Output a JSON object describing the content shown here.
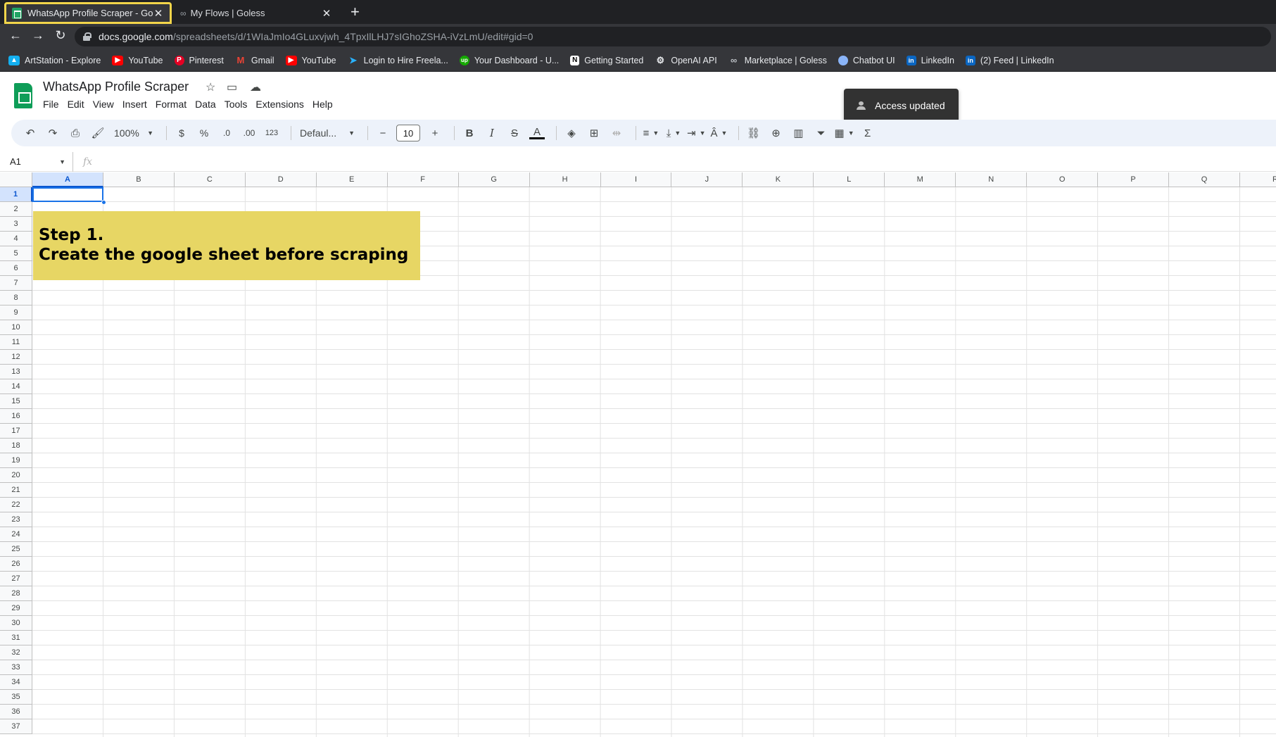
{
  "browser": {
    "tabs": [
      {
        "title": "WhatsApp Profile Scraper - Goog",
        "active": true
      },
      {
        "title": "My Flows | Goless",
        "active": false
      }
    ],
    "url_host": "docs.google.com",
    "url_path": "/spreadsheets/d/1WIaJmIo4GLuxvjwh_4TpxIlLHJ7sIGhoZSHA-iVzLmU/edit#gid=0",
    "bookmarks": [
      {
        "label": "ArtStation - Explore",
        "icon": "artstation-icon"
      },
      {
        "label": "YouTube",
        "icon": "youtube-icon"
      },
      {
        "label": "Pinterest",
        "icon": "pinterest-icon"
      },
      {
        "label": "Gmail",
        "icon": "gmail-icon"
      },
      {
        "label": "YouTube",
        "icon": "youtube-icon"
      },
      {
        "label": "Login to Hire Freela...",
        "icon": "freelancer-icon"
      },
      {
        "label": "Your Dashboard - U...",
        "icon": "upwork-icon"
      },
      {
        "label": "Getting Started",
        "icon": "notion-icon"
      },
      {
        "label": "OpenAI API",
        "icon": "openai-icon"
      },
      {
        "label": "Marketplace | Goless",
        "icon": "goless-icon"
      },
      {
        "label": "Chatbot UI",
        "icon": "chatbot-icon"
      },
      {
        "label": "LinkedIn",
        "icon": "linkedin-icon"
      },
      {
        "label": "(2) Feed | LinkedIn",
        "icon": "linkedin-icon"
      }
    ]
  },
  "sheet": {
    "title": "WhatsApp Profile Scraper",
    "menu": [
      "File",
      "Edit",
      "View",
      "Insert",
      "Format",
      "Data",
      "Tools",
      "Extensions",
      "Help"
    ],
    "toast": "Access updated",
    "toolbar": {
      "zoom": "100%",
      "currency": "$",
      "percent": "%",
      "decrease_decimal": ".0",
      "increase_decimal": ".00",
      "number_format": "123",
      "font": "Defaul...",
      "font_size": "10",
      "bold": "B",
      "italic": "I",
      "strikethrough": "S",
      "text_color": "A",
      "functions": "Σ"
    },
    "name_box": "A1",
    "fx": "fx",
    "columns": [
      "A",
      "B",
      "C",
      "D",
      "E",
      "F",
      "G",
      "H",
      "I",
      "J",
      "K",
      "L",
      "M",
      "N",
      "O",
      "P",
      "Q",
      "R"
    ],
    "rows": [
      "1",
      "2",
      "3",
      "4",
      "5",
      "6",
      "7",
      "8",
      "9",
      "10",
      "11",
      "12",
      "13",
      "14",
      "15",
      "16",
      "17",
      "18",
      "19",
      "20",
      "21",
      "22",
      "23",
      "24",
      "25",
      "26",
      "27",
      "28",
      "29",
      "30",
      "31",
      "32",
      "33",
      "34",
      "35",
      "36",
      "37"
    ],
    "note": {
      "line1": "Step 1.",
      "line2": "Create the google sheet before scraping"
    },
    "colors": {
      "note_background": "#e7d664",
      "selection": "#1a73e8",
      "brand_green": "#0f9d58"
    }
  }
}
